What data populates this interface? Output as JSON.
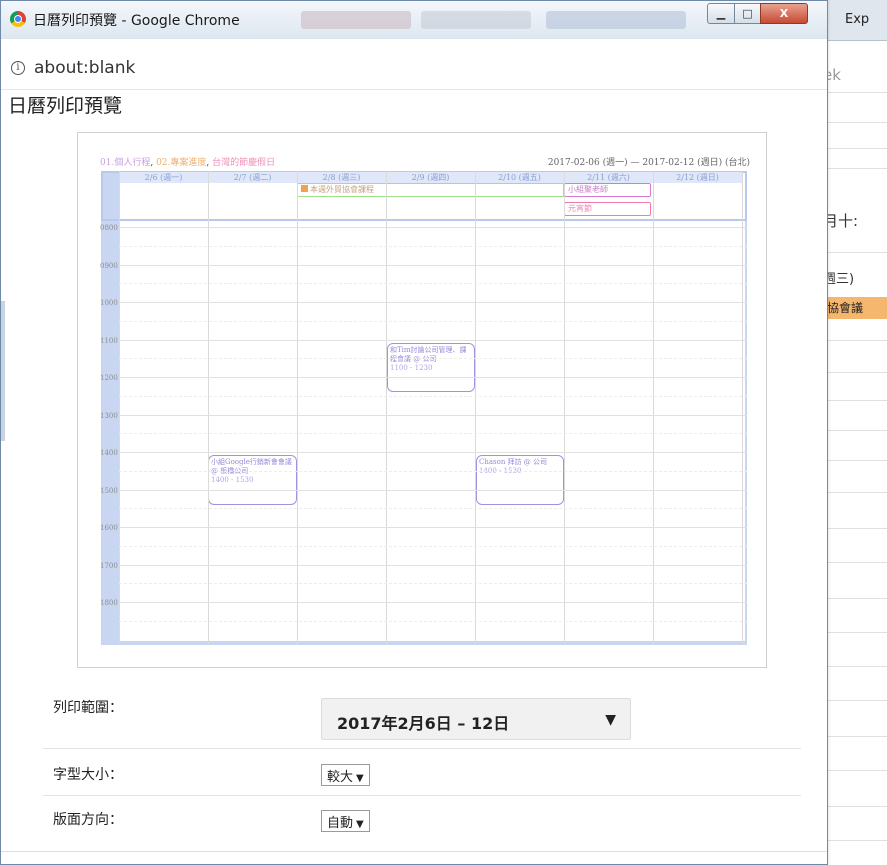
{
  "window": {
    "title": "日曆列印預覽 - Google Chrome",
    "buttons": {
      "minimize": "▁",
      "maximize": "□",
      "close": "X"
    }
  },
  "address": {
    "url": "about:blank"
  },
  "page_title": "日曆列印預覽",
  "background_window": {
    "tab_text": "Exp",
    "search_text": "ek",
    "date_text": "月十:",
    "weekday_text": "週三)",
    "event_badge": "協會議"
  },
  "calendar": {
    "legend": {
      "item1": "01.個人行程",
      "item2": "02.專案進度",
      "item3": "台灣的節慶假日",
      "sep": ","
    },
    "range_text": "2017-02-06 (週一) — 2017-02-12 (週日) (台北)",
    "days": [
      "2/6 (週一)",
      "2/7 (週二)",
      "2/8 (週三)",
      "2/9 (週四)",
      "2/10 (週五)",
      "2/11 (週六)",
      "2/12 (週日)"
    ],
    "hours": [
      "0800",
      "0900",
      "1000",
      "1100",
      "1200",
      "1300",
      "1400",
      "1500",
      "1600",
      "1700",
      "1800"
    ],
    "allday_events": [
      {
        "title": "本週外貿協會課程"
      },
      {
        "title": "小組聚老師"
      },
      {
        "title": "元宵節"
      }
    ],
    "timed_events": [
      {
        "title": "和Tim討論公司管理、課程會議 @ 公司",
        "time": "1100 - 1230"
      },
      {
        "title": "小組Google行銷新會會議 @ 板橋公司",
        "time": "1400 - 1530"
      },
      {
        "title": "Chason 拜訪 @ 公司",
        "time": "1400 - 1530"
      }
    ]
  },
  "settings": {
    "range_label": "列印範圍：",
    "range_value": "2017年2月6日 – 12日",
    "font_label": "字型大小：",
    "font_value": "較大",
    "orientation_label": "版面方向：",
    "orientation_value": "自動",
    "dropdown_arrow": "▼",
    "small_arrow": "▼"
  }
}
